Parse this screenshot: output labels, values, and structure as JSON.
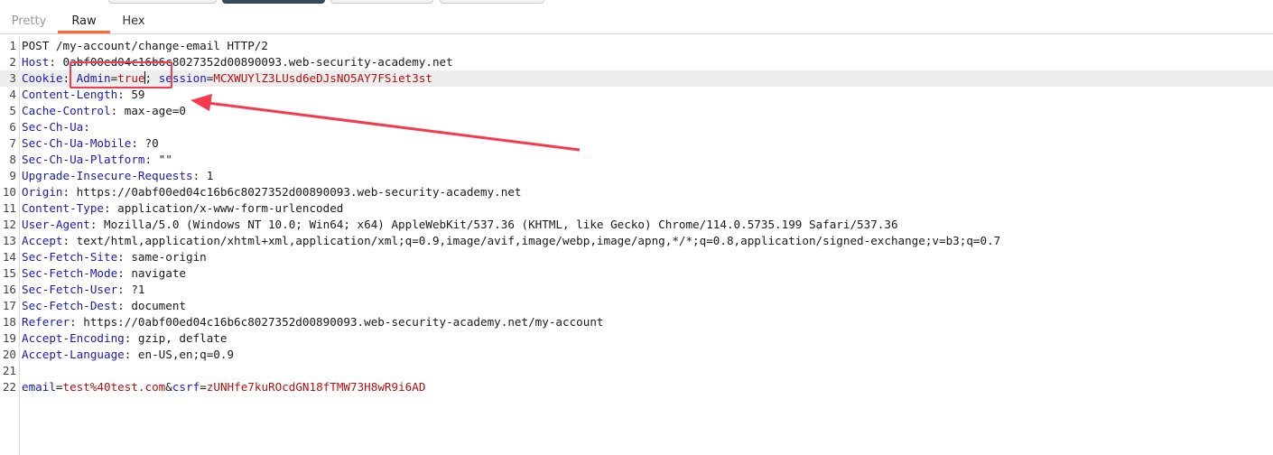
{
  "tabs": [
    {
      "label": "Pretty"
    },
    {
      "label": "Raw"
    },
    {
      "label": "Hex"
    }
  ],
  "active_tab": "Raw",
  "colors": {
    "accent": "#ff6633",
    "header_name": "#1a1ab0",
    "param_value": "#b41010",
    "annotation": "#f53a4f"
  },
  "request": {
    "lines": [
      {
        "n": "1",
        "request_line": "POST /my-account/change-email HTTP/2"
      },
      {
        "n": "2",
        "name": "Host",
        "value": "0abf00ed04c16b6c8027352d00890093.web-security-academy.net"
      },
      {
        "n": "3",
        "name": "Cookie",
        "cookie": {
          "c1_name": "Admin",
          "c1_value": "true",
          "c2_name": "session",
          "c2_value": "MCXWUYlZ3LUsd6eDJsNO5AY7FSiet3st"
        }
      },
      {
        "n": "4",
        "name": "Content-Length",
        "value": "59"
      },
      {
        "n": "5",
        "name": "Cache-Control",
        "value": "max-age=0"
      },
      {
        "n": "6",
        "name": "Sec-Ch-Ua",
        "value": ""
      },
      {
        "n": "7",
        "name": "Sec-Ch-Ua-Mobile",
        "value": "?0"
      },
      {
        "n": "8",
        "name": "Sec-Ch-Ua-Platform",
        "value": "\"\""
      },
      {
        "n": "9",
        "name": "Upgrade-Insecure-Requests",
        "value": "1"
      },
      {
        "n": "10",
        "name": "Origin",
        "value": "https://0abf00ed04c16b6c8027352d00890093.web-security-academy.net"
      },
      {
        "n": "11",
        "name": "Content-Type",
        "value": "application/x-www-form-urlencoded"
      },
      {
        "n": "12",
        "name": "User-Agent",
        "value": "Mozilla/5.0 (Windows NT 10.0; Win64; x64) AppleWebKit/537.36 (KHTML, like Gecko) Chrome/114.0.5735.199 Safari/537.36"
      },
      {
        "n": "13",
        "name": "Accept",
        "value": "text/html,application/xhtml+xml,application/xml;q=0.9,image/avif,image/webp,image/apng,*/*;q=0.8,application/signed-exchange;v=b3;q=0.7"
      },
      {
        "n": "14",
        "name": "Sec-Fetch-Site",
        "value": "same-origin"
      },
      {
        "n": "15",
        "name": "Sec-Fetch-Mode",
        "value": "navigate"
      },
      {
        "n": "16",
        "name": "Sec-Fetch-User",
        "value": "?1"
      },
      {
        "n": "17",
        "name": "Sec-Fetch-Dest",
        "value": "document"
      },
      {
        "n": "18",
        "name": "Referer",
        "value": "https://0abf00ed04c16b6c8027352d00890093.web-security-academy.net/my-account"
      },
      {
        "n": "19",
        "name": "Accept-Encoding",
        "value": "gzip, deflate"
      },
      {
        "n": "20",
        "name": "Accept-Language",
        "value": "en-US,en;q=0.9"
      },
      {
        "n": "21",
        "blank": true
      },
      {
        "n": "22",
        "body": {
          "p1_name": "email",
          "p1_value": "test%40test.com",
          "p2_name": "csrf",
          "p2_value": "zUNHfe7kuROcdGN18fTMW73H8wR9i6AD"
        }
      }
    ]
  }
}
